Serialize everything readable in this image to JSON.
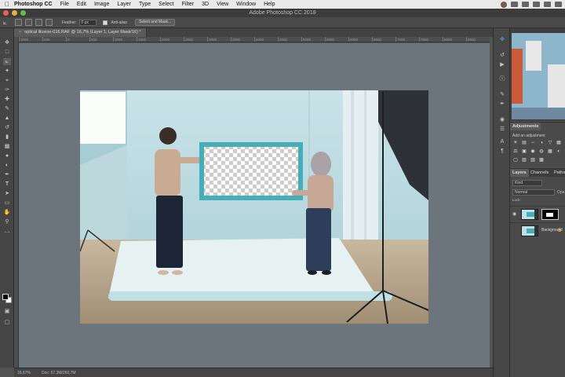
{
  "menubar": {
    "app_name": "Photoshop CC",
    "items": [
      "File",
      "Edit",
      "Image",
      "Layer",
      "Type",
      "Select",
      "Filter",
      "3D",
      "View",
      "Window",
      "Help"
    ]
  },
  "window": {
    "title": "Adobe Photoshop CC 2018"
  },
  "options": {
    "feather_label": "Feather:",
    "feather_value": "0 px",
    "antialias_label": "Anti-alias",
    "select_mask_label": "Select and Mask..."
  },
  "document": {
    "tab_title": "optical illusion-016.RAF @ 16,7% (Layer 1, Layer Mask/16) *",
    "tab_close": "×"
  },
  "ruler": {
    "ticks": [
      "1000",
      "500",
      "0",
      "500",
      "1000",
      "1500",
      "2000",
      "2500",
      "3000",
      "3500",
      "4000",
      "4500",
      "5000",
      "5500",
      "6000",
      "6500",
      "7000",
      "7500",
      "8000",
      "8500"
    ]
  },
  "status": {
    "zoom": "16,67%",
    "doc_info": "Doc: 57,3M/260,7M"
  },
  "panels": {
    "adjustments_tab": "Adjustments",
    "adjustments_hint": "Add an adjustment",
    "layers_tab": "Layers",
    "channels_tab": "Channels",
    "paths_tab": "Paths",
    "kind_filter": "Kind",
    "blend_mode": "Normal",
    "opacity_label": "Opa",
    "lock_label": "Lock:",
    "layers": [
      {
        "name": "",
        "has_mask": true,
        "selected": false
      },
      {
        "name": "Background",
        "has_mask": false,
        "selected": false
      }
    ]
  },
  "icons": {
    "tools": [
      "move-icon",
      "marquee-icon",
      "lasso-icon",
      "magic-wand-icon",
      "crop-icon",
      "eyedropper-icon",
      "healing-icon",
      "brush-icon",
      "clone-stamp-icon",
      "history-brush-icon",
      "eraser-icon",
      "gradient-icon",
      "blur-icon",
      "dodge-icon",
      "pen-icon",
      "type-icon",
      "path-selection-icon",
      "rectangle-icon",
      "hand-icon",
      "zoom-icon",
      "more-icon"
    ],
    "accent": "#4aa3d9"
  },
  "colors": {
    "canvas_bg": "#6c757c",
    "panel_bg": "#4a4a4a",
    "menubar_bg": "#e9e9e9"
  }
}
